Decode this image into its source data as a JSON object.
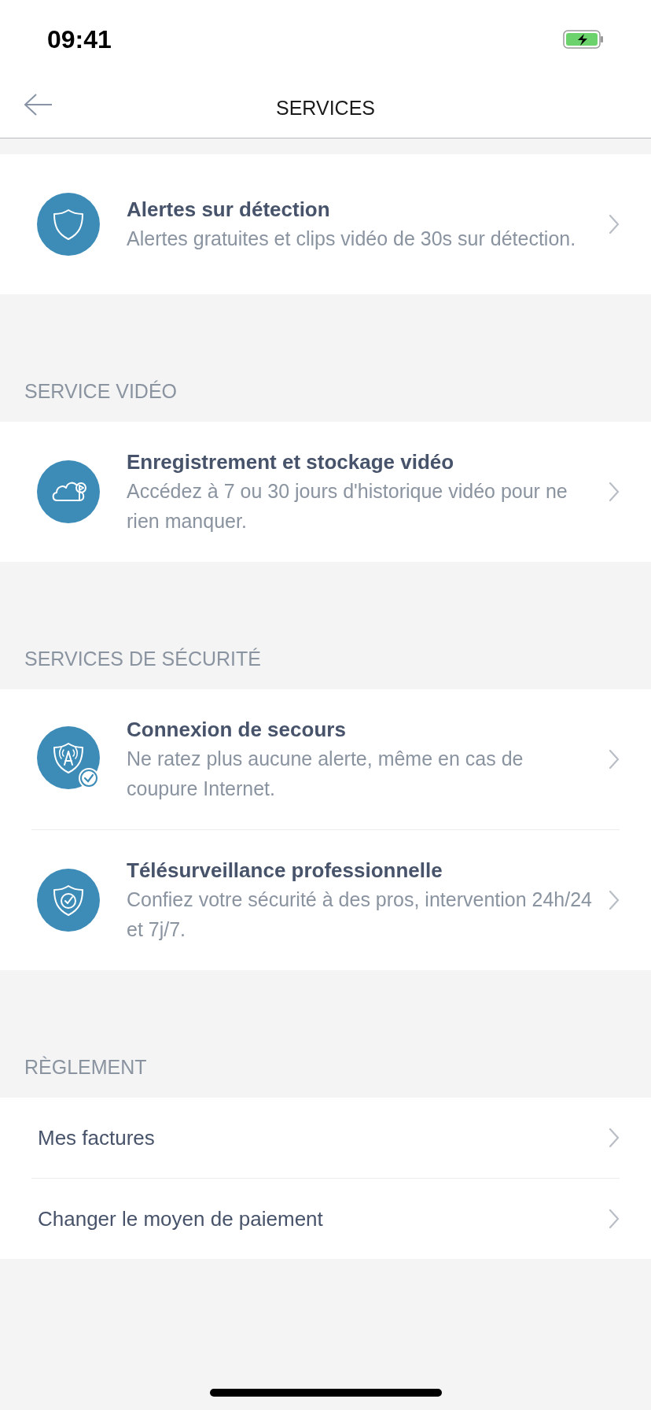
{
  "status_bar": {
    "time": "09:41"
  },
  "nav": {
    "title": "SERVICES"
  },
  "sections": [
    {
      "items": [
        {
          "kind": "service",
          "title": "Alertes sur détection",
          "description": "Alertes gratuites et clips vidéo de 30s sur détection."
        }
      ]
    },
    {
      "header": "SERVICE VIDÉO",
      "items": [
        {
          "kind": "service",
          "title": "Enregistrement et stockage vidéo",
          "description": "Accédez à 7 ou 30 jours d'historique vidéo pour ne rien manquer."
        }
      ]
    },
    {
      "header": "SERVICES DE SÉCURITÉ",
      "items": [
        {
          "kind": "service",
          "title": "Connexion de secours",
          "description": "Ne ratez plus aucune alerte, même en cas de coupure Internet."
        },
        {
          "kind": "service",
          "title": "Télésurveillance professionnelle",
          "description": "Confiez votre sécurité à des pros, intervention 24h/24 et 7j/7."
        }
      ]
    },
    {
      "header": "RÈGLEMENT",
      "items": [
        {
          "kind": "link",
          "title": "Mes factures"
        },
        {
          "kind": "link",
          "title": "Changer le moyen de paiement"
        }
      ]
    }
  ]
}
